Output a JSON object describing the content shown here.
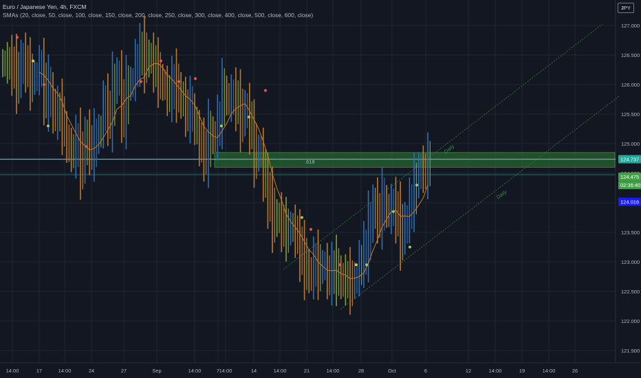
{
  "header": {
    "symbol_line": "Euro / Japanese Yen, 4h, FXCM",
    "sma_line": "SMAs (20, close, 50, close, 100, close, 150, close, 200, close, 250, close, 300, close, 400, close, 500, close, 600, close)"
  },
  "currency": "JPY",
  "colors": {
    "background": "#131722",
    "grid": "#1e2433",
    "up_candle": "#2f6fb5",
    "down_candle": "#c07a25",
    "mixed_candle": "#7ea33b",
    "sma": "#d07a1c",
    "zone": "#2e7d32",
    "hline": "#26c6da",
    "channel": "#2e7d32",
    "dot_red": "#ef5350",
    "dot_yellow": "#fbc02d",
    "dot_green": "#9ccc65",
    "last_price_badge": "#26a69a",
    "price_badge_green": "#43a047",
    "price_badge_blue": "#1a1aff"
  },
  "chart_data": {
    "type": "candlestick",
    "y_axis": {
      "range": [
        121.4,
        127.2
      ],
      "ticks": [
        "127.000",
        "126.500",
        "126.000",
        "125.500",
        "125.000",
        "124.500",
        "124.000",
        "123.500",
        "123.000",
        "122.500",
        "122.000",
        "121.500"
      ]
    },
    "x_axis": {
      "ticks": [
        "14:00",
        "17",
        "14:00",
        "24",
        "27",
        "Sep",
        "14:00",
        "7",
        "14:00",
        "14",
        "14:00",
        "21",
        "14:00",
        "28",
        "Oct",
        "6",
        "12",
        "14:00",
        "19",
        "14:00",
        "26"
      ]
    },
    "price_badges": {
      "current": "124.737",
      "line": "124.475",
      "countdown": "02:36:40",
      "lower": "124.016"
    },
    "fib_label": ".618",
    "channel_labels": [
      "Daily",
      "Daily"
    ],
    "zone": {
      "top": 124.85,
      "bottom": 124.6
    },
    "horizontal_lines": [
      124.737,
      124.475
    ],
    "close_path": [
      126.35,
      126.35,
      126.25,
      126.05,
      126.45,
      126.25,
      126.05,
      126.15,
      126.3,
      125.75,
      125.9,
      125.45,
      125.55,
      125.3,
      124.9,
      124.85,
      125.0,
      124.6,
      125.15,
      124.85,
      125.05,
      125.25,
      125.7,
      125.4,
      125.95,
      126.15,
      125.4,
      125.95,
      126.05,
      126.4,
      126.55,
      126.4,
      126.45,
      126.25,
      126.1,
      125.95,
      125.8,
      126.0,
      125.9,
      125.7,
      125.5,
      125.6,
      125.2,
      124.95,
      124.8,
      125.15,
      125.1,
      125.4,
      125.9,
      125.7,
      125.8,
      125.65,
      125.4,
      125.6,
      125.2,
      124.75,
      124.9,
      124.35,
      124.0,
      123.7,
      123.75,
      123.55,
      123.5,
      123.6,
      123.4,
      123.1,
      122.9,
      122.75,
      123.0,
      122.85,
      122.95,
      122.7,
      122.85,
      122.8,
      122.65,
      122.7,
      122.6,
      122.75,
      123.0,
      123.2,
      123.6,
      124.0,
      123.7,
      124.05,
      123.8,
      123.95,
      123.75,
      123.4,
      123.7,
      124.0,
      124.3,
      124.6,
      124.5,
      124.7
    ]
  }
}
